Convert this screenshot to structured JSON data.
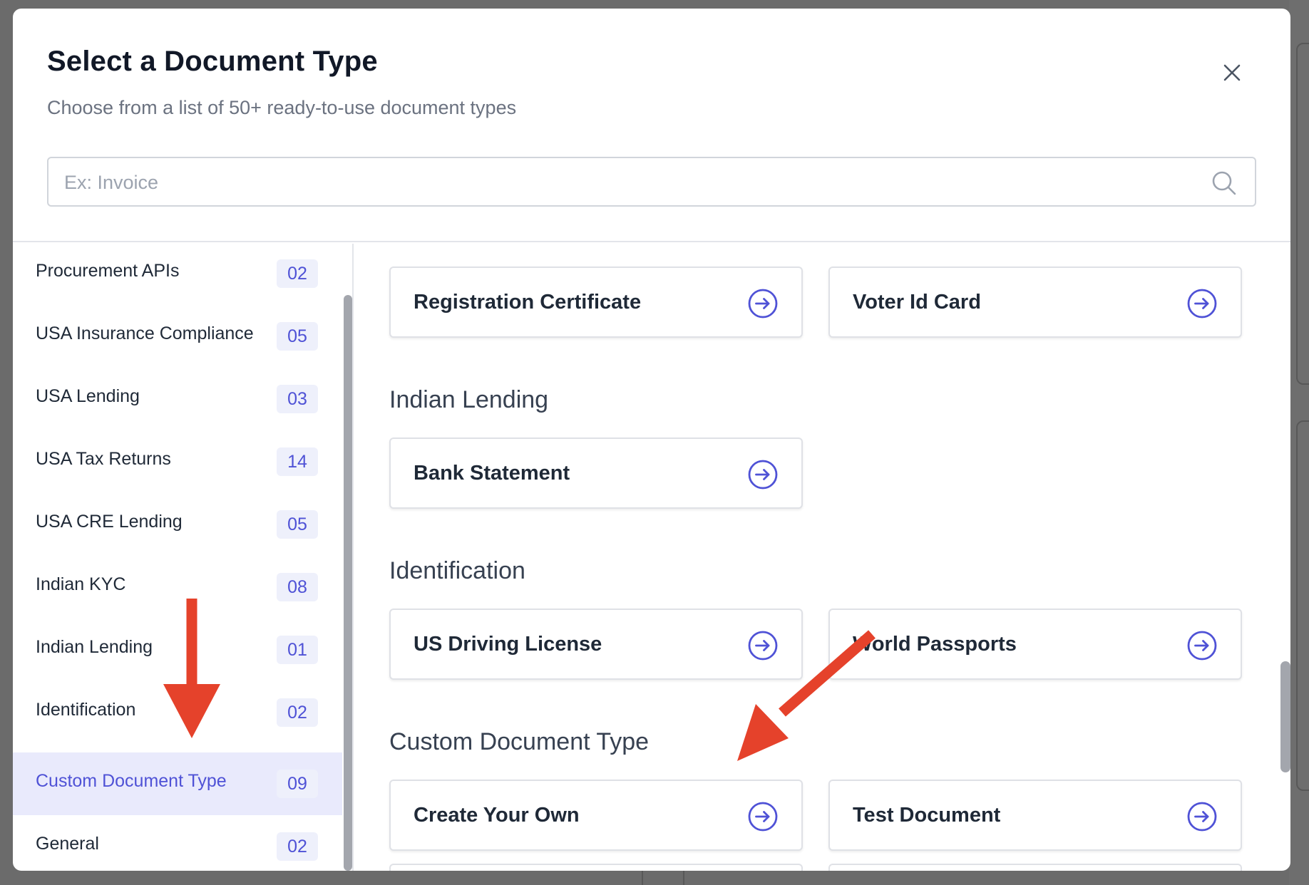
{
  "modal": {
    "title": "Select a Document Type",
    "subtitle": "Choose from a list of 50+ ready-to-use document types"
  },
  "search": {
    "placeholder": "Ex: Invoice",
    "value": ""
  },
  "icons": {
    "close": "close-icon",
    "search": "search-icon",
    "card_arrow": "arrow-right-circle-icon",
    "annotation": "red-arrow"
  },
  "colors": {
    "accent": "#4f52d6",
    "active_bg": "#e9eafc",
    "badge_bg": "#eef0fb",
    "annotation": "#e5422b"
  },
  "sidebar": {
    "items": [
      {
        "label": "Procurement APIs",
        "count": "02"
      },
      {
        "label": "USA Insurance Compliance",
        "count": "05"
      },
      {
        "label": "USA Lending",
        "count": "03"
      },
      {
        "label": "USA Tax Returns",
        "count": "14"
      },
      {
        "label": "USA CRE Lending",
        "count": "05"
      },
      {
        "label": "Indian KYC",
        "count": "08"
      },
      {
        "label": "Indian Lending",
        "count": "01"
      },
      {
        "label": "Identification",
        "count": "02"
      },
      {
        "label": "Custom Document Type",
        "count": "09",
        "active": true
      },
      {
        "label": "General",
        "count": "02"
      }
    ]
  },
  "content": {
    "top_cards": [
      {
        "label": "Registration Certificate"
      },
      {
        "label": "Voter Id Card"
      }
    ],
    "sections": [
      {
        "title": "Indian Lending",
        "cards": [
          {
            "label": "Bank Statement"
          }
        ]
      },
      {
        "title": "Identification",
        "cards": [
          {
            "label": "US Driving License"
          },
          {
            "label": "World Passports"
          }
        ]
      },
      {
        "title": "Custom Document Type",
        "cards": [
          {
            "label": "Create Your Own"
          },
          {
            "label": "Test Document"
          }
        ]
      }
    ]
  }
}
